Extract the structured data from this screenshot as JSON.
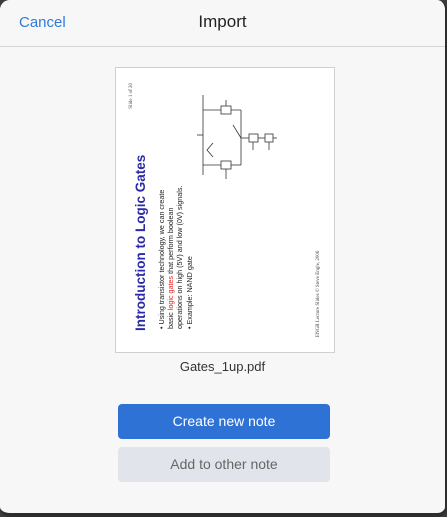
{
  "header": {
    "cancel_label": "Cancel",
    "title": "Import"
  },
  "preview": {
    "slide_title": "Introduction to Logic Gates",
    "bullet1_pre": "Using transistor technology, we can create basic ",
    "bullet1_highlight": "logic gates",
    "bullet1_post": " that perform boolean operations on high (5V) and low (0V) signals.",
    "bullet2": "Example: NAND gate",
    "page_number": "Slide 1 of 20",
    "footer": "ENGR Lecture Slides © Steve Engle, 2006",
    "filename": "Gates_1up.pdf"
  },
  "actions": {
    "primary_label": "Create new note",
    "secondary_label": "Add to other note"
  },
  "colors": {
    "accent": "#2f72d6",
    "link": "#2f7bd9",
    "slide_title": "#2a2aa8",
    "highlight": "#d22"
  }
}
